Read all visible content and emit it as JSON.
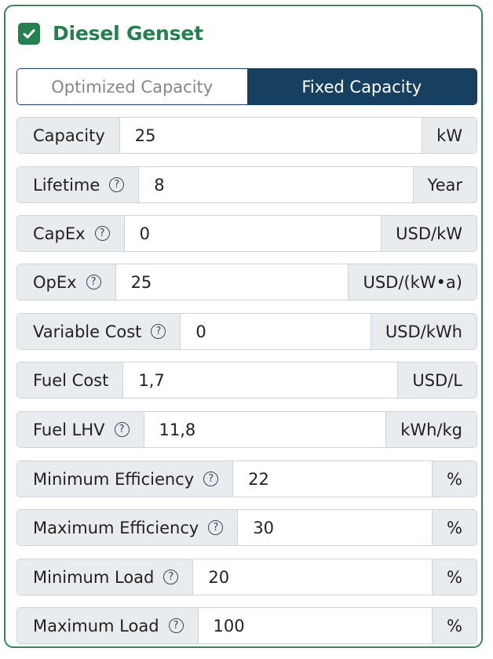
{
  "section": {
    "title": "Diesel Genset",
    "checked": true
  },
  "mode_toggle": {
    "options": [
      "Optimized Capacity",
      "Fixed Capacity"
    ],
    "selected": "Fixed Capacity"
  },
  "fields": [
    {
      "label": "Capacity",
      "has_help": false,
      "value": "25",
      "unit": "kW"
    },
    {
      "label": "Lifetime",
      "has_help": true,
      "value": "8",
      "unit": "Year"
    },
    {
      "label": "CapEx",
      "has_help": true,
      "value": "0",
      "unit": "USD/kW"
    },
    {
      "label": "OpEx",
      "has_help": true,
      "value": "25",
      "unit": "USD/(kW•a)"
    },
    {
      "label": "Variable Cost",
      "has_help": true,
      "value": "0",
      "unit": "USD/kWh"
    },
    {
      "label": "Fuel Cost",
      "has_help": false,
      "value": "1,7",
      "unit": "USD/L"
    },
    {
      "label": "Fuel LHV",
      "has_help": true,
      "value": "11,8",
      "unit": "kWh/kg"
    },
    {
      "label": "Minimum Efficiency",
      "has_help": true,
      "value": "22",
      "unit": "%"
    },
    {
      "label": "Maximum Efficiency",
      "has_help": true,
      "value": "30",
      "unit": "%"
    },
    {
      "label": "Minimum Load",
      "has_help": true,
      "value": "20",
      "unit": "%"
    },
    {
      "label": "Maximum Load",
      "has_help": true,
      "value": "100",
      "unit": "%"
    }
  ],
  "help_glyph": "?",
  "colors": {
    "accent_green": "#25804f",
    "toggle_active": "#173f5f",
    "addon_bg": "#e9ecef"
  }
}
